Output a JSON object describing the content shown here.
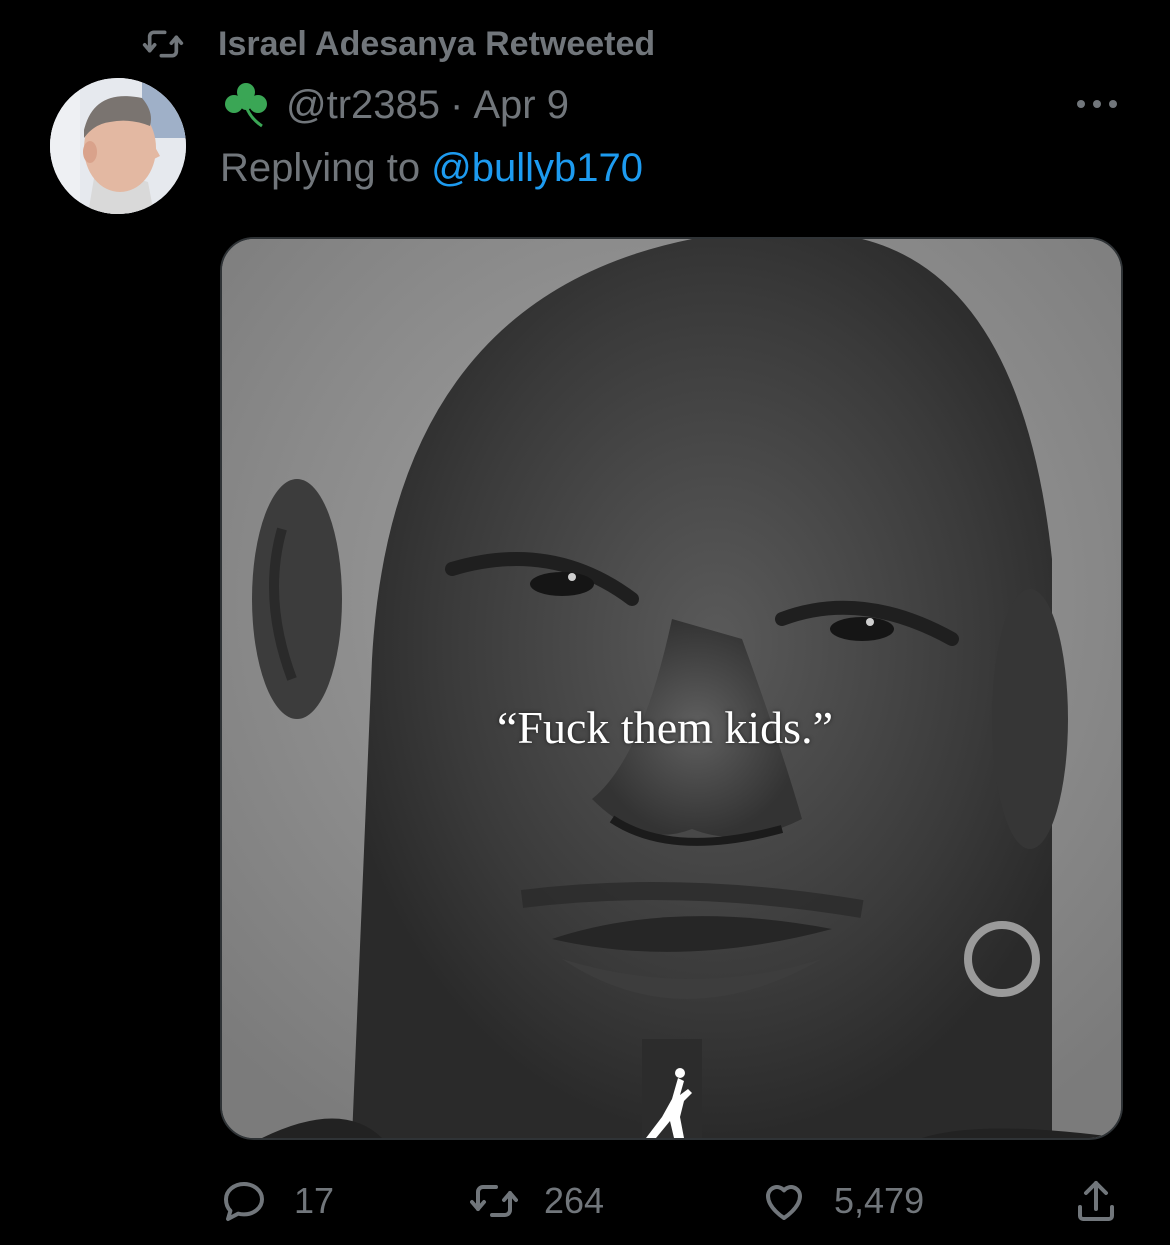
{
  "retweet_banner": {
    "text": "Israel Adesanya Retweeted",
    "icon": "retweet-icon"
  },
  "author": {
    "handle": "@tr2385",
    "separator": "·",
    "date": "Apr 9",
    "badge_icon": "shamrock-icon",
    "avatar": "profile-photo"
  },
  "reply": {
    "prefix": "Replying to",
    "mention": "@bullyb170"
  },
  "media": {
    "caption": "“Fuck them kids.”",
    "logo": "jumpman-logo"
  },
  "actions": {
    "replies": "17",
    "retweets": "264",
    "likes": "5,479"
  },
  "colors": {
    "background": "#000000",
    "secondary_text": "#71767b",
    "link": "#1d9bf0",
    "shamrock": "#3aa655"
  }
}
